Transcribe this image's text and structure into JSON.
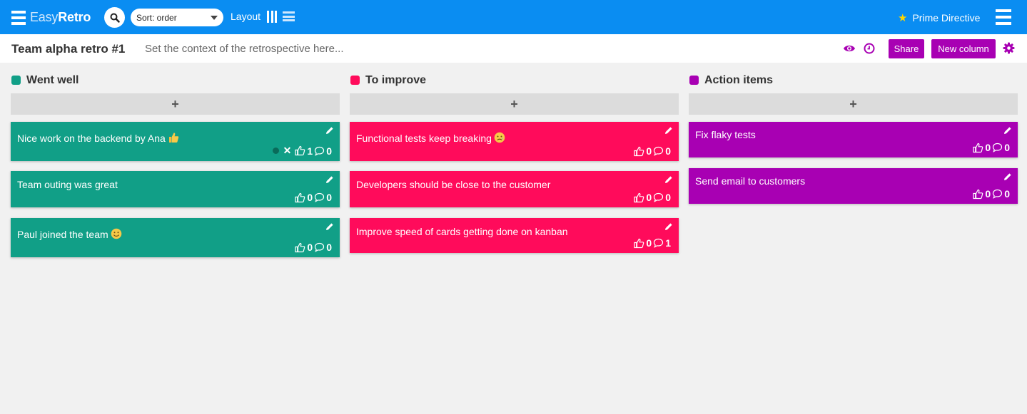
{
  "header": {
    "logo_light": "Easy",
    "logo_bold": "Retro",
    "sort_label": "Sort: order",
    "layout_label": "Layout",
    "prime_directive": "Prime Directive"
  },
  "board": {
    "title": "Team alpha retro #1",
    "context": "Set the context of the retrospective here...",
    "share_label": "Share",
    "new_column_label": "New column"
  },
  "colors": {
    "topbar": "#0a8df2",
    "went_well": "#119f87",
    "to_improve": "#ff0b5b",
    "action_items": "#a800b3"
  },
  "add_label": "+",
  "columns": [
    {
      "title": "Went well",
      "cards": [
        {
          "text": "Nice work on the backend by Ana",
          "emoji": "thumbs-up-emoji",
          "likes": "1",
          "comments": "0"
        },
        {
          "text": "Team outing was great",
          "likes": "0",
          "comments": "0"
        },
        {
          "text": "Paul joined the team",
          "emoji": "smile-emoji",
          "likes": "0",
          "comments": "0"
        }
      ]
    },
    {
      "title": "To improve",
      "cards": [
        {
          "text": "Functional tests keep breaking",
          "emoji": "sad-emoji",
          "likes": "0",
          "comments": "0"
        },
        {
          "text": "Developers should be close to the customer",
          "likes": "0",
          "comments": "0"
        },
        {
          "text": "Improve speed of cards getting done on kanban",
          "likes": "0",
          "comments": "1"
        }
      ]
    },
    {
      "title": "Action items",
      "cards": [
        {
          "text": "Fix flaky tests",
          "likes": "0",
          "comments": "0"
        },
        {
          "text": "Send email to customers",
          "likes": "0",
          "comments": "0"
        }
      ]
    }
  ]
}
